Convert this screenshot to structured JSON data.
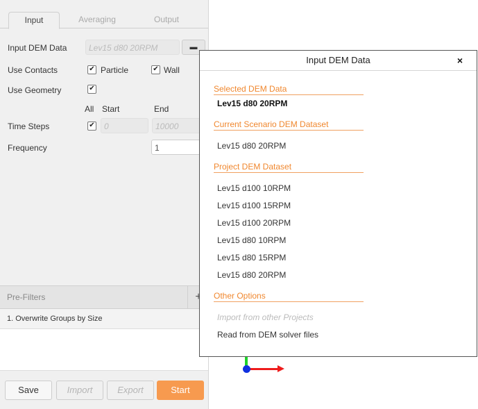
{
  "tabs": [
    "Input",
    "Averaging",
    "Output"
  ],
  "form": {
    "input_dem_label": "Input DEM Data",
    "input_dem_value": "Lev15 d80 20RPM",
    "folder_icon": "folder-icon",
    "use_contacts_label": "Use Contacts",
    "particle_label": "Particle",
    "wall_label": "Wall",
    "use_geometry_label": "Use Geometry",
    "all_header": "All",
    "start_header": "Start",
    "end_header": "End",
    "time_steps_label": "Time Steps",
    "start_value": "0",
    "end_value": "10000",
    "frequency_label": "Frequency",
    "frequency_value": "1",
    "check_mark": "✔"
  },
  "prefilters": {
    "title": "Pre-Filters",
    "add": "+",
    "items": [
      "1. Overwrite Groups by Size"
    ]
  },
  "buttons": {
    "save": "Save",
    "import": "Import",
    "export": "Export",
    "start": "Start"
  },
  "axes_colors": {
    "x": "#ee1c1c",
    "y": "#1fd12b",
    "origin": "#1030e0"
  },
  "dialog": {
    "title": "Input DEM Data",
    "close": "×",
    "selected_header": "Selected DEM Data",
    "selected_value": "Lev15 d80 20RPM",
    "current_header": "Current Scenario DEM Dataset",
    "current_items": [
      "Lev15 d80 20RPM"
    ],
    "project_header": "Project DEM Dataset",
    "project_items": [
      "Lev15 d100 10RPM",
      "Lev15 d100 15RPM",
      "Lev15 d100 20RPM",
      "Lev15 d80 10RPM",
      "Lev15 d80 15RPM",
      "Lev15 d80 20RPM"
    ],
    "other_header": "Other Options",
    "other_items": [
      "Import from other Projects",
      "Read from DEM solver files"
    ]
  },
  "colors": {
    "accent": "#f0872e",
    "start_button": "#f79a4f"
  }
}
